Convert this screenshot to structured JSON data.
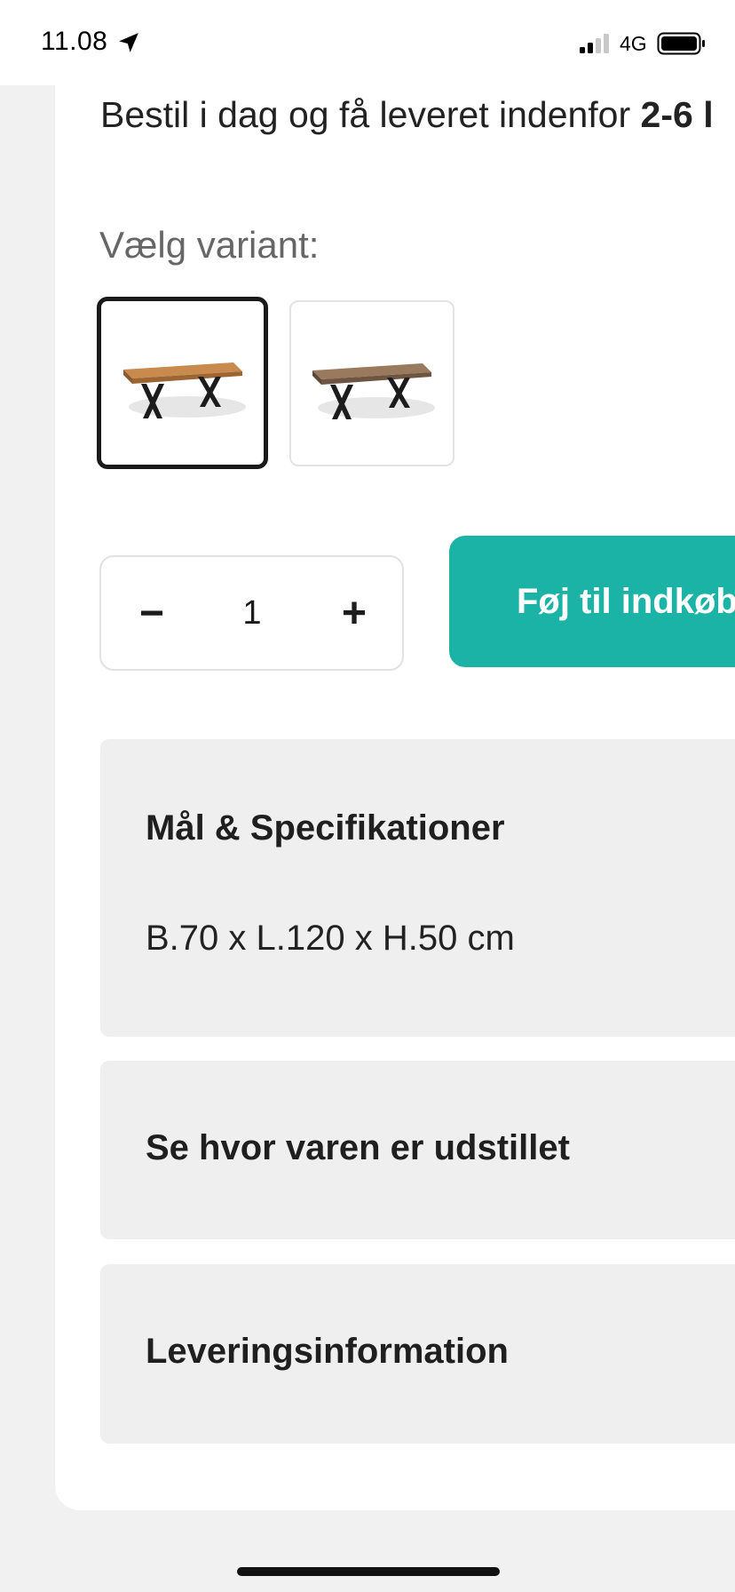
{
  "status_bar": {
    "time": "11.08",
    "network": "4G",
    "icons": [
      "location-arrow-icon",
      "signal-icon",
      "battery-icon"
    ]
  },
  "product": {
    "delivery_prefix": "Bestil i dag og få leveret indenfor ",
    "delivery_bold": "2-6 l",
    "variant_label": "Vælg variant:",
    "variants": [
      {
        "name": "light-oak-table",
        "selected": true
      },
      {
        "name": "dark-oak-table",
        "selected": false
      }
    ],
    "quantity": {
      "minus": "−",
      "value": "1",
      "plus": "+"
    },
    "add_to_cart": "Føj til indkøb"
  },
  "panels": {
    "specs_title": "Mål & Specifikationer",
    "specs_value": "B.70 x L.120 x H.50 cm",
    "showroom_title": "Se hvor varen er udstillet",
    "delivery_title": "Leveringsinformation"
  },
  "colors": {
    "accent": "#1ab3a6",
    "panel_bg": "#efefef",
    "page_bg": "#f1f1f1",
    "selected_border": "#1a1a1a"
  }
}
